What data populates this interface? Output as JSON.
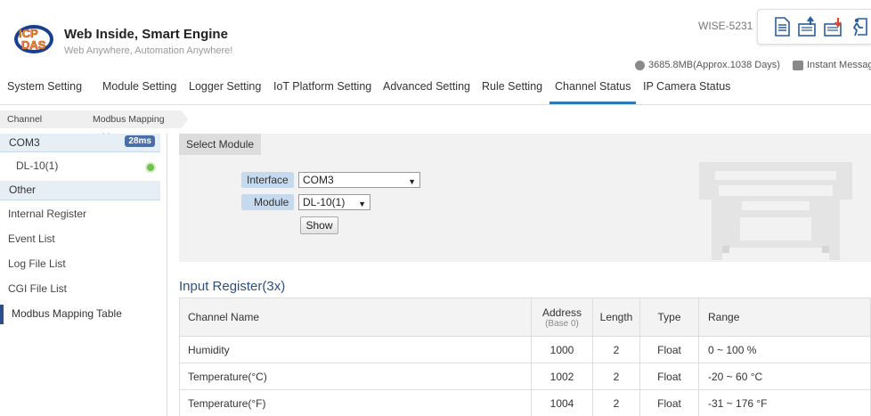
{
  "header": {
    "brand_title": "Web Inside, Smart Engine",
    "brand_subtitle": "Web Anywhere, Automation Anywhere!",
    "logo_text": "ICP DAS",
    "model": "WISE-5231",
    "storage_status": "3685.8MB(Approx.1038 Days)",
    "instant_message": "Instant Message",
    "icons": [
      "document-icon",
      "upload-icon",
      "download-icon",
      "logout-icon"
    ]
  },
  "nav": {
    "items": [
      {
        "label": "System Setting"
      },
      {
        "label": "Module Setting"
      },
      {
        "label": "Logger Setting"
      },
      {
        "label": "IoT Platform Setting"
      },
      {
        "label": "Advanced Setting"
      },
      {
        "label": "Rule Setting"
      },
      {
        "label": "Channel Status",
        "active": true
      },
      {
        "label": "IP Camera Status"
      }
    ]
  },
  "breadcrumb": [
    "Channel Status",
    "Modbus Mapping Table"
  ],
  "sidebar": {
    "com_label": "COM3",
    "com_badge": "28ms",
    "device_label": "DL-10(1)",
    "other_label": "Other",
    "items": [
      {
        "label": "Internal Register"
      },
      {
        "label": "Event List"
      },
      {
        "label": "Log File List"
      },
      {
        "label": "CGI File List"
      },
      {
        "label": "Modbus Mapping Table",
        "active": true
      }
    ]
  },
  "select_module": {
    "tab_label": "Select Module",
    "interface_label": "Interface",
    "interface_value": "COM3",
    "module_label": "Module",
    "module_value": "DL-10(1)",
    "show_button": "Show"
  },
  "input_register": {
    "title": "Input Register(3x)",
    "headers": {
      "channel_name": "Channel Name",
      "address": "Address",
      "address_sub": "(Base 0)",
      "length": "Length",
      "type": "Type",
      "range": "Range"
    },
    "rows": [
      {
        "name": "Humidity",
        "address": "1000",
        "length": "2",
        "type": "Float",
        "range": "0 ~ 100 %"
      },
      {
        "name": "Temperature(°C)",
        "address": "1002",
        "length": "2",
        "type": "Float",
        "range": "-20 ~ 60 °C"
      },
      {
        "name": "Temperature(°F)",
        "address": "1004",
        "length": "2",
        "type": "Float",
        "range": "-31 ~ 176 °F"
      }
    ]
  },
  "colors": {
    "accent": "#2a7ab8",
    "badge": "#4a6ea9",
    "status_ok": "#6cc24a",
    "label_bg": "#c5d9ef"
  }
}
